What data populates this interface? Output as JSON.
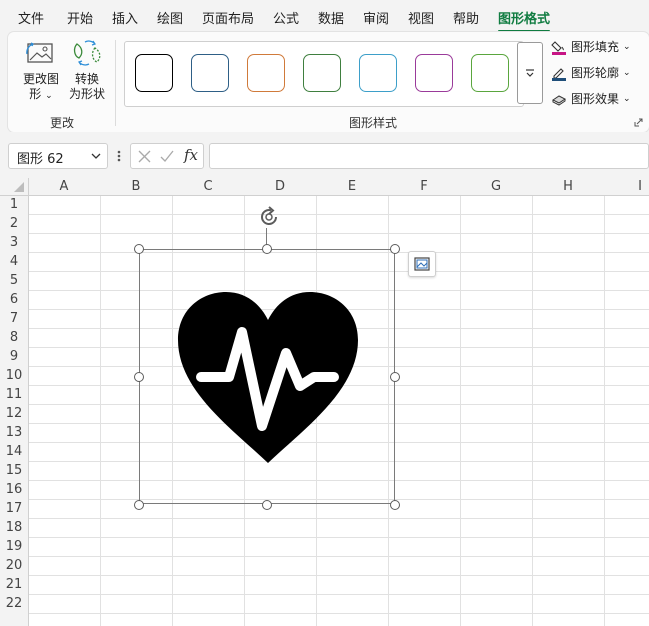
{
  "menu": {
    "items": [
      "文件",
      "开始",
      "插入",
      "绘图",
      "页面布局",
      "公式",
      "数据",
      "审阅",
      "视图",
      "帮助",
      "图形格式"
    ],
    "active_index": 10
  },
  "ribbon": {
    "change_graphic_line1": "更改图",
    "change_graphic_line2": "形",
    "convert_line1": "转换",
    "convert_line2": "为形状",
    "group_change": "更改",
    "group_styles": "图形样式",
    "fill_label": "图形填充",
    "outline_label": "图形轮廓",
    "effects_label": "图形效果",
    "fill_color": "#c71585",
    "outline_color": "#1f4e79",
    "style_swatches": [
      {
        "color": "#000000",
        "icon": "style-black"
      },
      {
        "color": "#2e5f86",
        "icon": "style-blue"
      },
      {
        "color": "#d07a3a",
        "icon": "style-orange"
      },
      {
        "color": "#3f7f3f",
        "icon": "style-green"
      },
      {
        "color": "#3d9fc9",
        "icon": "style-lightblue"
      },
      {
        "color": "#9a3a9a",
        "icon": "style-purple"
      },
      {
        "color": "#5aa63e",
        "icon": "style-lightgreen"
      }
    ]
  },
  "formula_bar": {
    "name_box": "图形 62",
    "fx_label": "fx",
    "value": ""
  },
  "sheet": {
    "columns": [
      "A",
      "B",
      "C",
      "D",
      "E",
      "F",
      "G",
      "H",
      "I"
    ],
    "rows": [
      "1",
      "2",
      "3",
      "4",
      "5",
      "6",
      "7",
      "8",
      "9",
      "10",
      "11",
      "12",
      "13",
      "14",
      "15",
      "16",
      "17",
      "18",
      "19",
      "20",
      "21",
      "22"
    ],
    "selected_shape": "heart-pulse-icon"
  }
}
